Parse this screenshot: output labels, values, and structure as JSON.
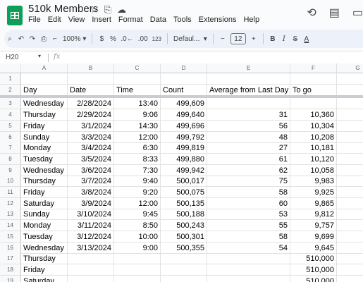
{
  "title_bar": {
    "doc_title": "510k Members",
    "menus": [
      "File",
      "Edit",
      "View",
      "Insert",
      "Format",
      "Data",
      "Tools",
      "Extensions",
      "Help"
    ]
  },
  "toolbar": {
    "zoom": "100%",
    "currency": "$",
    "percent": "%",
    "decrease_decimal": ".0←",
    "increase_decimal": ".00",
    "more_formats": "123",
    "font": "Defaul...",
    "font_size": "12",
    "bold": "B",
    "italic": "I",
    "strikethrough": "S",
    "text_color": "A"
  },
  "formula_bar": {
    "name_box": "H20",
    "fx": "fx"
  },
  "columns": [
    "A",
    "B",
    "C",
    "D",
    "E",
    "F",
    "G"
  ],
  "rows": [
    {
      "n": "1",
      "c": [
        "",
        "",
        "",
        "",
        "",
        "",
        ""
      ]
    },
    {
      "n": "2",
      "c": [
        "Day",
        "Date",
        "Time",
        "Count",
        "Average from Last Day",
        "To go",
        ""
      ]
    },
    {
      "n": "3",
      "c": [
        "Wednesday",
        "2/28/2024",
        "13:40",
        "499,609",
        "",
        "",
        ""
      ]
    },
    {
      "n": "4",
      "c": [
        "Thursday",
        "2/29/2024",
        "9:06",
        "499,640",
        "31",
        "10,360",
        ""
      ]
    },
    {
      "n": "5",
      "c": [
        "Friday",
        "3/1/2024",
        "14:30",
        "499,696",
        "56",
        "10,304",
        ""
      ]
    },
    {
      "n": "6",
      "c": [
        "Sunday",
        "3/3/2024",
        "12:00",
        "499,792",
        "48",
        "10,208",
        ""
      ]
    },
    {
      "n": "7",
      "c": [
        "Monday",
        "3/4/2024",
        "6:30",
        "499,819",
        "27",
        "10,181",
        ""
      ]
    },
    {
      "n": "8",
      "c": [
        "Tuesday",
        "3/5/2024",
        "8:33",
        "499,880",
        "61",
        "10,120",
        ""
      ]
    },
    {
      "n": "9",
      "c": [
        "Wednesday",
        "3/6/2024",
        "7:30",
        "499,942",
        "62",
        "10,058",
        ""
      ]
    },
    {
      "n": "10",
      "c": [
        "Thursday",
        "3/7/2024",
        "9:40",
        "500,017",
        "75",
        "9,983",
        ""
      ]
    },
    {
      "n": "11",
      "c": [
        "Friday",
        "3/8/2024",
        "9:20",
        "500,075",
        "58",
        "9,925",
        ""
      ]
    },
    {
      "n": "12",
      "c": [
        "Saturday",
        "3/9/2024",
        "12:00",
        "500,135",
        "60",
        "9,865",
        ""
      ]
    },
    {
      "n": "13",
      "c": [
        "Sunday",
        "3/10/2024",
        "9:45",
        "500,188",
        "53",
        "9,812",
        ""
      ]
    },
    {
      "n": "14",
      "c": [
        "Monday",
        "3/11/2024",
        "8:50",
        "500,243",
        "55",
        "9,757",
        ""
      ]
    },
    {
      "n": "15",
      "c": [
        "Tuesday",
        "3/12/2024",
        "10:00",
        "500,301",
        "58",
        "9,699",
        ""
      ]
    },
    {
      "n": "16",
      "c": [
        "Wednesday",
        "3/13/2024",
        "9:00",
        "500,355",
        "54",
        "9,645",
        ""
      ]
    },
    {
      "n": "17",
      "c": [
        "Thursday",
        "",
        "",
        "",
        "",
        "510,000",
        ""
      ]
    },
    {
      "n": "18",
      "c": [
        "Friday",
        "",
        "",
        "",
        "",
        "510,000",
        ""
      ]
    },
    {
      "n": "19",
      "c": [
        "Saturday",
        "",
        "",
        "",
        "",
        "510,000",
        ""
      ]
    }
  ]
}
